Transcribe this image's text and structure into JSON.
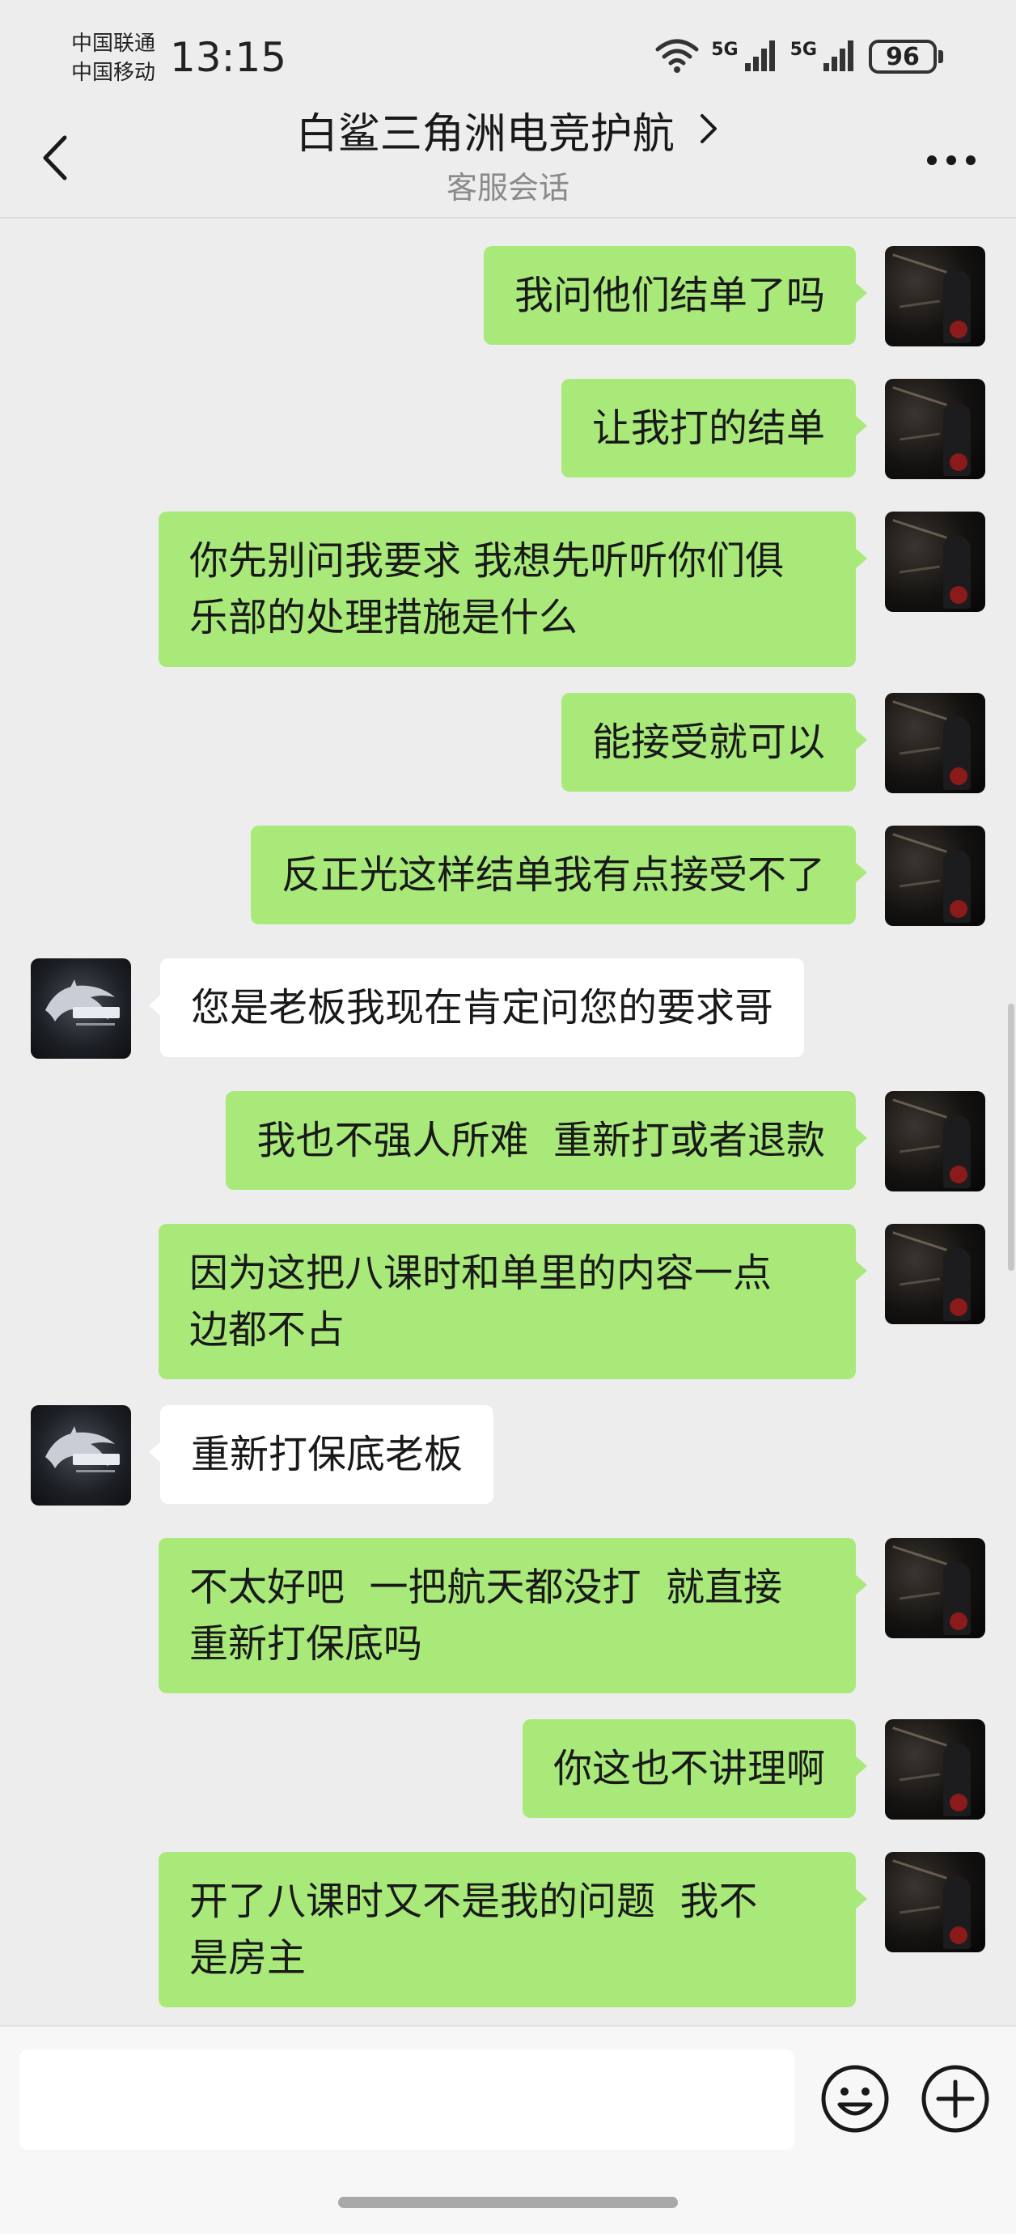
{
  "status_bar": {
    "carrier_1": "中国联通",
    "carrier_2": "中国移动",
    "time": "13:15",
    "network_1": "5G",
    "network_2": "5G",
    "battery": "96",
    "icons": [
      "wifi-icon",
      "signal-icon",
      "signal-icon",
      "battery-icon"
    ]
  },
  "header": {
    "title": "白鲨三角洲电竞护航",
    "subtitle": "客服会话",
    "icons": [
      "back-arrow-icon",
      "chevron-right-icon",
      "more-dots-icon"
    ]
  },
  "messages": [
    {
      "from": "me",
      "text": "我问他们结单了吗"
    },
    {
      "from": "me",
      "text": "让我打的结单"
    },
    {
      "from": "me",
      "text": "你先别问我要求 我想先听听你们俱\n乐部的处理措施是什么"
    },
    {
      "from": "me",
      "text": "能接受就可以"
    },
    {
      "from": "me",
      "text": "反正光这样结单我有点接受不了"
    },
    {
      "from": "service",
      "text": "您是老板我现在肯定问您的要求哥"
    },
    {
      "from": "me",
      "text": "我也不强人所难  重新打或者退款"
    },
    {
      "from": "me",
      "text": "因为这把八课时和单里的内容一点\n边都不占"
    },
    {
      "from": "service",
      "text": "重新打保底老板"
    },
    {
      "from": "me",
      "text": "不太好吧  一把航天都没打  就直接\n重新打保底吗"
    },
    {
      "from": "me",
      "text": "你这也不讲理啊"
    },
    {
      "from": "me",
      "text": "开了八课时又不是我的问题  我不\n是房主"
    }
  ],
  "input_bar": {
    "placeholder": "",
    "icons": [
      "emoji-icon",
      "plus-icon"
    ]
  },
  "colors": {
    "background": "#ededed",
    "outgoing_bubble": "#a9e97a",
    "incoming_bubble": "#ffffff",
    "subtitle": "#8a8a8a"
  }
}
